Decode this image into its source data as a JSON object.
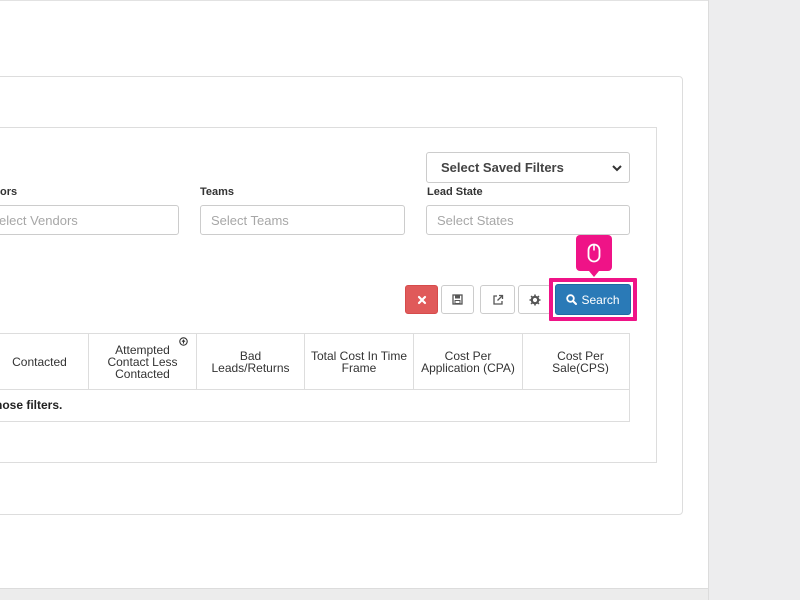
{
  "filters": {
    "saved_filters_select": "Select Saved Filters",
    "vendors_label": "ors",
    "vendors_placeholder": "elect Vendors",
    "teams_label": "Teams",
    "teams_placeholder": "Select Teams",
    "lead_state_label": "Lead State",
    "lead_state_placeholder": "Select States"
  },
  "toolbar": {
    "clear_icon": "times-icon",
    "save_icon": "floppy-disk-icon",
    "export_icon": "external-link-icon",
    "settings_icon": "gear-icon",
    "search_label": "Search",
    "search_icon": "search-icon"
  },
  "table": {
    "columns": [
      "Contacted",
      "Attempted Contact Less Contacted",
      "Bad Leads/Returns",
      "Total Cost In Time Frame",
      "Cost Per Application (CPA)",
      "Cost Per Sale(CPS)"
    ],
    "empty_message": "those filters."
  },
  "colors": {
    "highlight": "#ef1387",
    "primary": "#2a7ab7",
    "danger": "#e05a5a"
  }
}
